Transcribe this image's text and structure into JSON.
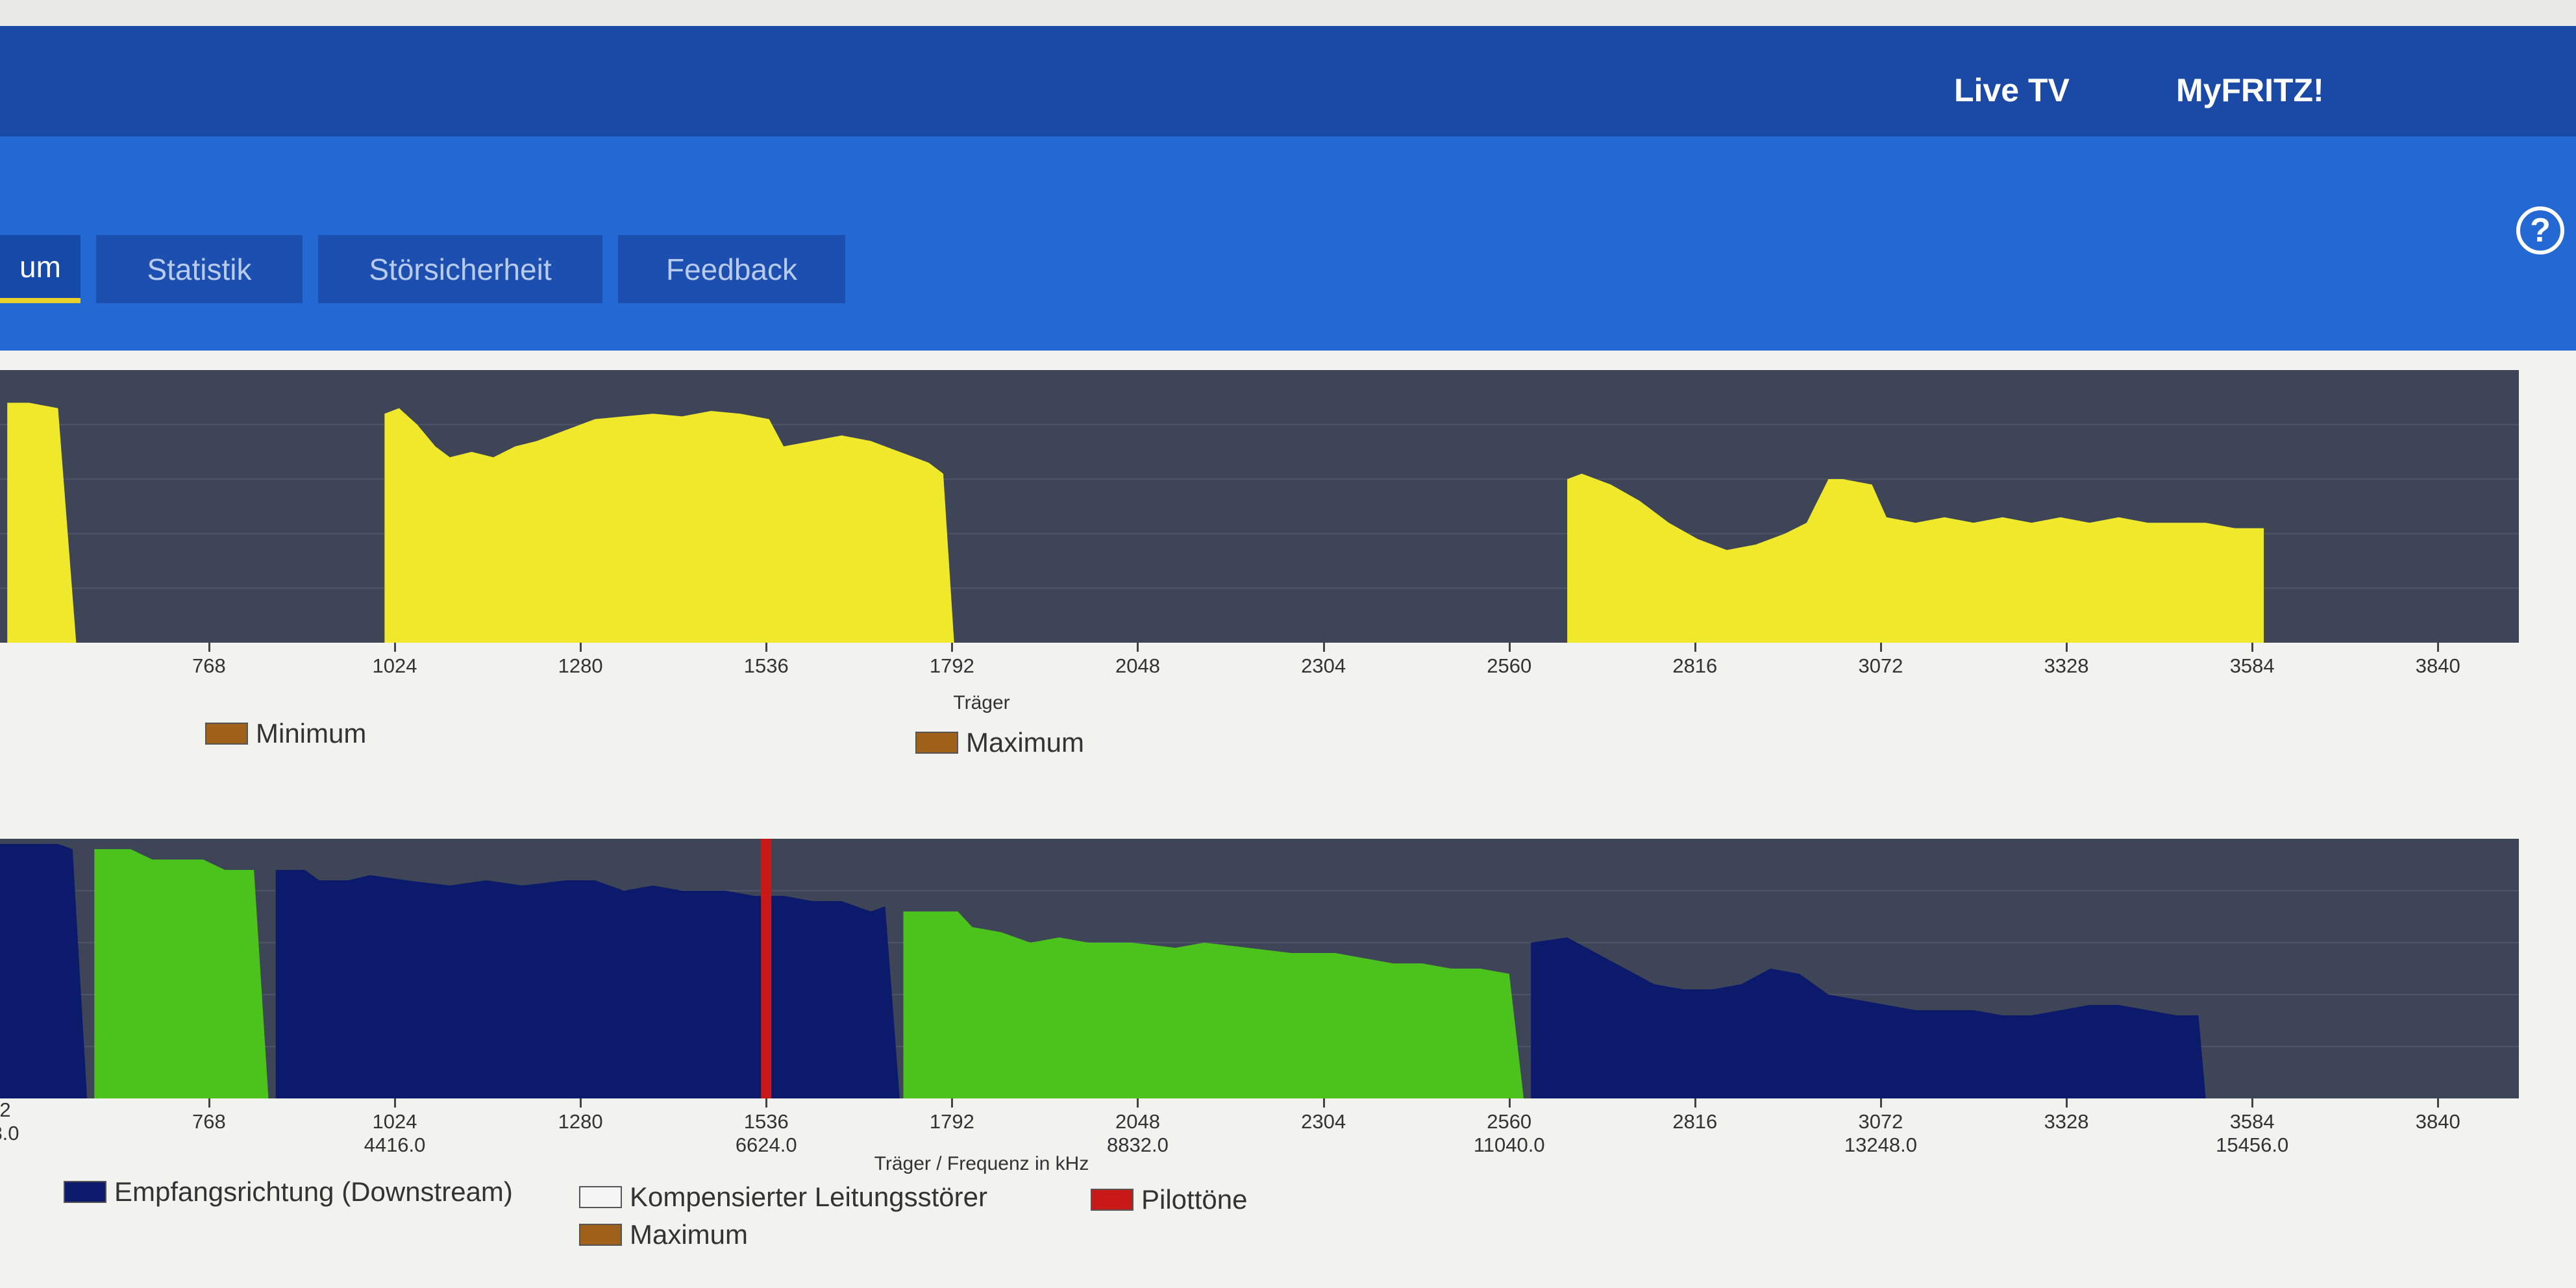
{
  "header": {
    "links": [
      "Live TV",
      "MyFRITZ!"
    ],
    "help_symbol": "?"
  },
  "tabs": [
    {
      "label": "um",
      "active": true
    },
    {
      "label": "Statistik",
      "active": false
    },
    {
      "label": "Störsicherheit",
      "active": false
    },
    {
      "label": "Feedback",
      "active": false
    }
  ],
  "colors": {
    "header": "#1a4aa6",
    "subheader": "#2468d4",
    "chart_bg": "#3e4556",
    "yellow": "#f0e82a",
    "downstream": "#0c1a6b",
    "upstream": "#4cc21c",
    "pilot": "#c81818",
    "minmax": "#a0621a"
  },
  "chart_data": [
    {
      "type": "area",
      "x_ticks": [
        "768",
        "1024",
        "1280",
        "1536",
        "1792",
        "2048",
        "2304",
        "2560",
        "2816",
        "3072",
        "3328",
        "3584",
        "3840"
      ],
      "xlabel": "Träger",
      "legend": [
        {
          "label": "Minimum",
          "color": "#a0621a"
        },
        {
          "label": "Maximum",
          "color": "#a0621a"
        }
      ],
      "series": [
        {
          "color": "#f0e82a",
          "points": [
            [
              490,
              0.88
            ],
            [
              520,
              0.88
            ],
            [
              560,
              0.86
            ],
            [
              585,
              0.0
            ]
          ]
        },
        {
          "color": "#f0e82a",
          "points": [
            [
              1010,
              0.84
            ],
            [
              1030,
              0.86
            ],
            [
              1055,
              0.8
            ],
            [
              1080,
              0.72
            ],
            [
              1100,
              0.68
            ],
            [
              1130,
              0.7
            ],
            [
              1160,
              0.68
            ],
            [
              1190,
              0.72
            ],
            [
              1220,
              0.74
            ],
            [
              1260,
              0.78
            ],
            [
              1300,
              0.82
            ],
            [
              1340,
              0.83
            ],
            [
              1380,
              0.84
            ],
            [
              1420,
              0.83
            ],
            [
              1460,
              0.85
            ],
            [
              1500,
              0.84
            ],
            [
              1540,
              0.82
            ],
            [
              1560,
              0.72
            ],
            [
              1600,
              0.74
            ],
            [
              1640,
              0.76
            ],
            [
              1680,
              0.74
            ],
            [
              1720,
              0.7
            ],
            [
              1760,
              0.66
            ],
            [
              1780,
              0.62
            ],
            [
              1795,
              0.0
            ]
          ]
        },
        {
          "color": "#f0e82a",
          "points": [
            [
              2640,
              0.6
            ],
            [
              2660,
              0.62
            ],
            [
              2700,
              0.58
            ],
            [
              2740,
              0.52
            ],
            [
              2780,
              0.44
            ],
            [
              2820,
              0.38
            ],
            [
              2860,
              0.34
            ],
            [
              2900,
              0.36
            ],
            [
              2940,
              0.4
            ],
            [
              2970,
              0.44
            ],
            [
              3000,
              0.6
            ],
            [
              3020,
              0.6
            ],
            [
              3060,
              0.58
            ],
            [
              3080,
              0.46
            ],
            [
              3120,
              0.44
            ],
            [
              3160,
              0.46
            ],
            [
              3200,
              0.44
            ],
            [
              3240,
              0.46
            ],
            [
              3280,
              0.44
            ],
            [
              3320,
              0.46
            ],
            [
              3360,
              0.44
            ],
            [
              3400,
              0.46
            ],
            [
              3440,
              0.44
            ],
            [
              3480,
              0.44
            ],
            [
              3520,
              0.44
            ],
            [
              3560,
              0.42
            ],
            [
              3600,
              0.42
            ]
          ]
        }
      ]
    },
    {
      "type": "area",
      "x_ticks": [
        {
          "label": "768",
          "sub": ""
        },
        {
          "label": "1024",
          "sub": "4416.0"
        },
        {
          "label": "1280",
          "sub": ""
        },
        {
          "label": "1536",
          "sub": "6624.0"
        },
        {
          "label": "1792",
          "sub": ""
        },
        {
          "label": "2048",
          "sub": "8832.0"
        },
        {
          "label": "2304",
          "sub": ""
        },
        {
          "label": "2560",
          "sub": "11040.0"
        },
        {
          "label": "2816",
          "sub": ""
        },
        {
          "label": "3072",
          "sub": "13248.0"
        },
        {
          "label": "3328",
          "sub": ""
        },
        {
          "label": "3584",
          "sub": "15456.0"
        },
        {
          "label": "3840",
          "sub": ""
        }
      ],
      "partial_left_labels": [
        "2",
        "8.0"
      ],
      "xlabel": "Träger / Frequenz in kHz",
      "legend": [
        {
          "label": "Empfangsrichtung (Downstream)",
          "color": "#0c1a6b"
        },
        {
          "label": "Kompensierter Leitungsstörer",
          "color": "#f5f5f5"
        },
        {
          "label": "Pilottöne",
          "color": "#c81818"
        },
        {
          "label": "Maximum",
          "color": "#a0621a"
        }
      ],
      "pilot_carrier": 1536,
      "series": [
        {
          "name": "Empfangsrichtung (Downstream)",
          "color": "#0c1a6b",
          "points": [
            [
              480,
              0.98
            ],
            [
              560,
              0.98
            ],
            [
              580,
              0.96
            ],
            [
              600,
              0.0
            ]
          ]
        },
        {
          "name": "",
          "color": "#4cc21c",
          "points": [
            [
              610,
              0.96
            ],
            [
              660,
              0.96
            ],
            [
              690,
              0.92
            ],
            [
              760,
              0.92
            ],
            [
              790,
              0.88
            ],
            [
              830,
              0.88
            ],
            [
              850,
              0.0
            ]
          ]
        },
        {
          "name": "Empfangsrichtung (Downstream)",
          "color": "#0c1a6b",
          "points": [
            [
              860,
              0.88
            ],
            [
              900,
              0.88
            ],
            [
              920,
              0.84
            ],
            [
              960,
              0.84
            ],
            [
              990,
              0.86
            ],
            [
              1040,
              0.84
            ],
            [
              1100,
              0.82
            ],
            [
              1150,
              0.84
            ],
            [
              1200,
              0.82
            ],
            [
              1260,
              0.84
            ],
            [
              1300,
              0.84
            ],
            [
              1340,
              0.8
            ],
            [
              1380,
              0.82
            ],
            [
              1420,
              0.8
            ],
            [
              1480,
              0.8
            ],
            [
              1520,
              0.78
            ],
            [
              1560,
              0.78
            ],
            [
              1600,
              0.76
            ],
            [
              1640,
              0.76
            ],
            [
              1680,
              0.72
            ],
            [
              1700,
              0.74
            ],
            [
              1720,
              0.0
            ]
          ]
        },
        {
          "name": "",
          "color": "#4cc21c",
          "points": [
            [
              1725,
              0.72
            ],
            [
              1760,
              0.72
            ],
            [
              1800,
              0.72
            ],
            [
              1820,
              0.66
            ],
            [
              1860,
              0.64
            ],
            [
              1900,
              0.6
            ],
            [
              1940,
              0.62
            ],
            [
              1980,
              0.6
            ],
            [
              2040,
              0.6
            ],
            [
              2100,
              0.58
            ],
            [
              2140,
              0.6
            ],
            [
              2200,
              0.58
            ],
            [
              2260,
              0.56
            ],
            [
              2320,
              0.56
            ],
            [
              2360,
              0.54
            ],
            [
              2400,
              0.52
            ],
            [
              2440,
              0.52
            ],
            [
              2480,
              0.5
            ],
            [
              2520,
              0.5
            ],
            [
              2560,
              0.48
            ],
            [
              2580,
              0.0
            ]
          ]
        },
        {
          "name": "Empfangsrichtung (Downstream)",
          "color": "#0c1a6b",
          "points": [
            [
              2590,
              0.6
            ],
            [
              2640,
              0.62
            ],
            [
              2680,
              0.56
            ],
            [
              2720,
              0.5
            ],
            [
              2760,
              0.44
            ],
            [
              2800,
              0.42
            ],
            [
              2840,
              0.42
            ],
            [
              2880,
              0.44
            ],
            [
              2920,
              0.5
            ],
            [
              2960,
              0.48
            ],
            [
              3000,
              0.4
            ],
            [
              3040,
              0.38
            ],
            [
              3080,
              0.36
            ],
            [
              3120,
              0.34
            ],
            [
              3160,
              0.34
            ],
            [
              3200,
              0.34
            ],
            [
              3240,
              0.32
            ],
            [
              3280,
              0.32
            ],
            [
              3320,
              0.34
            ],
            [
              3360,
              0.36
            ],
            [
              3400,
              0.36
            ],
            [
              3440,
              0.34
            ],
            [
              3480,
              0.32
            ],
            [
              3510,
              0.32
            ],
            [
              3520,
              0.0
            ]
          ]
        }
      ]
    }
  ]
}
